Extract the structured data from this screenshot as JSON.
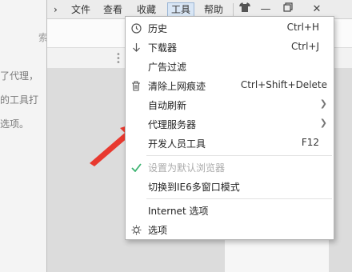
{
  "article": {
    "line1": "了代理，",
    "line2": "的工具打",
    "line3": "选项。",
    "hint": "索"
  },
  "menubar": {
    "file": "文件",
    "view": "查看",
    "favorites": "收藏",
    "tools": "工具",
    "help": "帮助"
  },
  "tools_menu": {
    "items": [
      {
        "label": "历史",
        "shortcut": "Ctrl+H",
        "icon": "clock-icon"
      },
      {
        "label": "下载器",
        "shortcut": "Ctrl+J",
        "icon": "download-icon"
      },
      {
        "label": "广告过滤",
        "shortcut": "",
        "icon": ""
      },
      {
        "label": "清除上网痕迹",
        "shortcut": "Ctrl+Shift+Delete",
        "icon": "trash-icon"
      },
      {
        "label": "自动刷新",
        "shortcut": "",
        "icon": ""
      },
      {
        "label": "代理服务器",
        "shortcut": "",
        "icon": ""
      },
      {
        "label": "开发人员工具",
        "shortcut": "F12",
        "icon": ""
      },
      {
        "label": "设置为默认浏览器",
        "shortcut": "",
        "icon": "check-icon"
      },
      {
        "label": "切换到IE6多窗口模式",
        "shortcut": "",
        "icon": ""
      },
      {
        "label": "Internet 选项",
        "shortcut": "",
        "icon": ""
      },
      {
        "label": "选项",
        "shortcut": "",
        "icon": "gear-icon"
      }
    ]
  },
  "colors": {
    "annotation_arrow": "#e8392f",
    "check": "#3cb371",
    "menu_active": "#d9e6f5"
  }
}
